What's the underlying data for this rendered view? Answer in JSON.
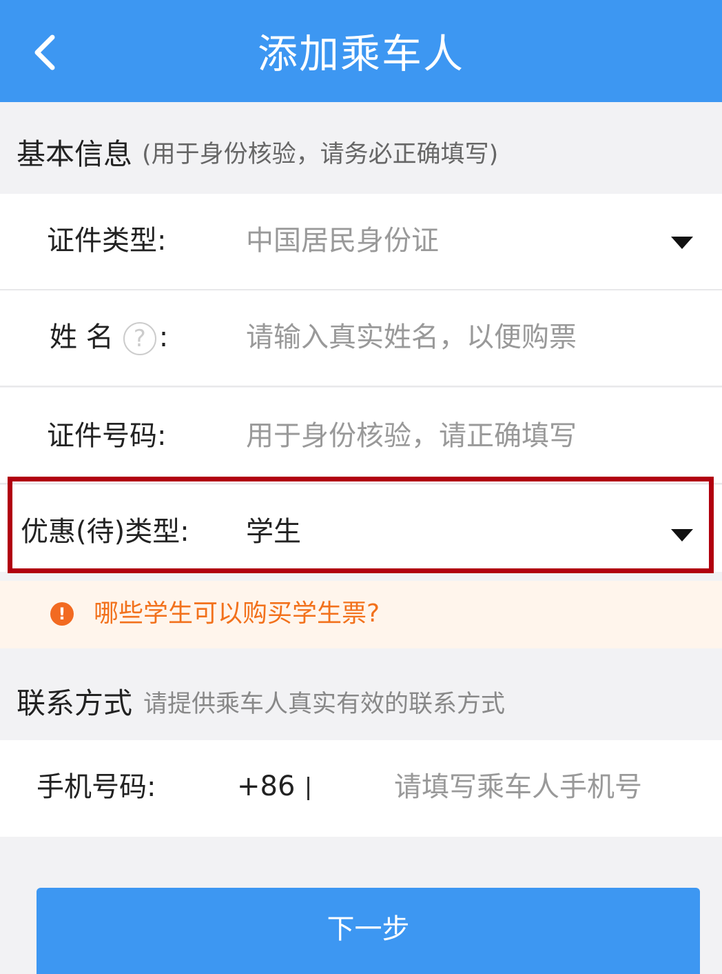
{
  "nav": {
    "title": "添加乘车人",
    "back_icon": "chevron-left-icon"
  },
  "basic_info": {
    "title": "基本信息",
    "hint": "(用于身份核验，请务必正确填写)"
  },
  "fields": {
    "id_type": {
      "label": "证件类型:",
      "value": "中国居民身份证"
    },
    "name": {
      "label_name": "姓 名",
      "help_icon": "?",
      "colon": ":",
      "placeholder": "请输入真实姓名，以便购票"
    },
    "id_number": {
      "label": "证件号码:",
      "placeholder": "用于身份核验，请正确填写"
    },
    "discount_type": {
      "label": "优惠(待)类型:",
      "value": "学生"
    }
  },
  "notice": {
    "icon": "!",
    "text": "哪些学生可以购买学生票?"
  },
  "contact": {
    "title": "联系方式",
    "hint": "请提供乘车人真实有效的联系方式",
    "phone_label": "手机号码:",
    "phone_prefix": "+86",
    "phone_placeholder": "请填写乘车人手机号"
  },
  "buttons": {
    "next": "下一步"
  },
  "colors": {
    "primary": "#3d97f2",
    "highlight_border": "#b1000f",
    "notice_text": "#f2711c",
    "notice_bg": "#fff5ec"
  }
}
